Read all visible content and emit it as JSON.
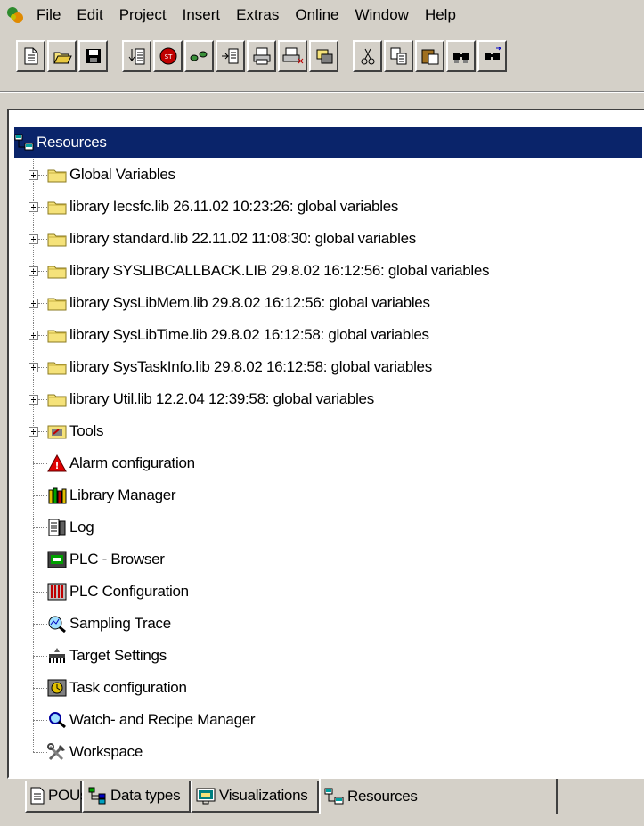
{
  "menu": {
    "items": [
      "File",
      "Edit",
      "Project",
      "Insert",
      "Extras",
      "Online",
      "Window",
      "Help"
    ]
  },
  "toolbar": {
    "buttons": [
      {
        "icon": "new-icon"
      },
      {
        "icon": "open-icon"
      },
      {
        "icon": "save-icon"
      },
      {
        "icon": "login-icon"
      },
      {
        "icon": "stop-icon"
      },
      {
        "icon": "run-icon"
      },
      {
        "icon": "step-in-icon"
      },
      {
        "icon": "print-icon"
      },
      {
        "icon": "print-preview-icon"
      },
      {
        "icon": "debug-icon"
      },
      {
        "icon": "cut-icon"
      },
      {
        "icon": "copy-icon"
      },
      {
        "icon": "paste-icon"
      },
      {
        "icon": "find-icon"
      },
      {
        "icon": "find-next-icon"
      }
    ]
  },
  "tree": {
    "root": {
      "label": "Resources",
      "icon": "resources-icon"
    },
    "items": [
      {
        "label": "Global Variables",
        "icon": "folder-icon",
        "expandable": true
      },
      {
        "label": "library Iecsfc.lib 26.11.02 10:23:26: global variables",
        "icon": "folder-icon",
        "expandable": true
      },
      {
        "label": "library standard.lib 22.11.02 11:08:30: global variables",
        "icon": "folder-icon",
        "expandable": true
      },
      {
        "label": "library SYSLIBCALLBACK.LIB 29.8.02 16:12:56: global variables",
        "icon": "folder-icon",
        "expandable": true
      },
      {
        "label": "library SysLibMem.lib 29.8.02 16:12:56: global variables",
        "icon": "folder-icon",
        "expandable": true
      },
      {
        "label": "library SysLibTime.lib 29.8.02 16:12:58: global variables",
        "icon": "folder-icon",
        "expandable": true
      },
      {
        "label": "library SysTaskInfo.lib 29.8.02 16:12:58: global variables",
        "icon": "folder-icon",
        "expandable": true
      },
      {
        "label": "library Util.lib 12.2.04 12:39:58: global variables",
        "icon": "folder-icon",
        "expandable": true
      },
      {
        "label": "Tools",
        "icon": "tools-icon",
        "expandable": true
      },
      {
        "label": "Alarm configuration",
        "icon": "alarm-icon",
        "expandable": false
      },
      {
        "label": "Library Manager",
        "icon": "library-icon",
        "expandable": false
      },
      {
        "label": "Log",
        "icon": "log-icon",
        "expandable": false
      },
      {
        "label": "PLC - Browser",
        "icon": "plc-browser-icon",
        "expandable": false
      },
      {
        "label": "PLC Configuration",
        "icon": "plc-config-icon",
        "expandable": false
      },
      {
        "label": "Sampling Trace",
        "icon": "trace-icon",
        "expandable": false
      },
      {
        "label": "Target Settings",
        "icon": "target-icon",
        "expandable": false
      },
      {
        "label": "Task configuration",
        "icon": "task-icon",
        "expandable": false
      },
      {
        "label": "Watch- and Recipe Manager",
        "icon": "watch-icon",
        "expandable": false
      },
      {
        "label": "Workspace",
        "icon": "workspace-icon",
        "expandable": false
      }
    ]
  },
  "tabs": [
    {
      "label": "POUs",
      "icon": "pou-icon",
      "active": false
    },
    {
      "label": "Data types",
      "icon": "datatypes-icon",
      "active": false
    },
    {
      "label": "Visualizations",
      "icon": "visualization-icon",
      "active": false
    },
    {
      "label": "Resources",
      "icon": "resources-icon",
      "active": true
    }
  ],
  "colors": {
    "selection": "#0a246a",
    "face": "#d4d0c8",
    "folder": "#f5e27a"
  }
}
